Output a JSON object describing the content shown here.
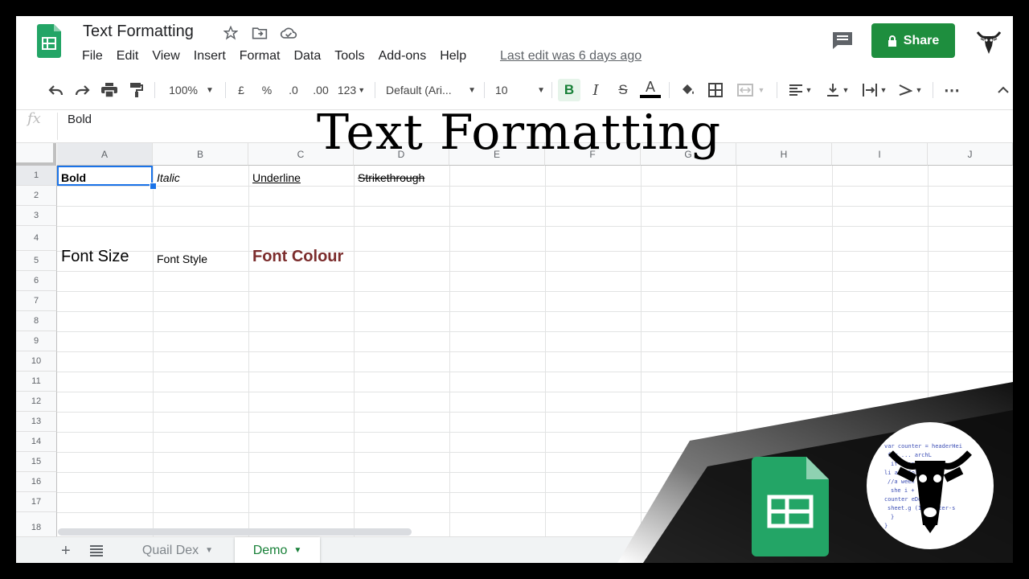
{
  "document": {
    "title": "Text Formatting"
  },
  "menu": {
    "items": [
      "File",
      "Edit",
      "View",
      "Insert",
      "Format",
      "Data",
      "Tools",
      "Add-ons",
      "Help"
    ],
    "last_edit": "Last edit was 6 days ago"
  },
  "share": {
    "label": "Share"
  },
  "toolbar": {
    "zoom": "100%",
    "currency": "£",
    "percent": "%",
    "dec_decrease": ".0",
    "dec_increase": ".00",
    "more_formats": "123",
    "font": "Default (Ari...",
    "font_size": "10",
    "bold": "B",
    "italic": "I",
    "strike": "S",
    "text_color": "A"
  },
  "formula_bar": {
    "fx": "fx",
    "value": "Bold"
  },
  "overlay": {
    "title": "Text Formatting"
  },
  "grid": {
    "columns": [
      "A",
      "B",
      "C",
      "D",
      "E",
      "F",
      "G",
      "H",
      "I",
      "J"
    ],
    "rows": [
      "1",
      "2",
      "3",
      "4",
      "5",
      "6",
      "7",
      "8",
      "9",
      "10",
      "11",
      "12",
      "13",
      "14",
      "15",
      "16",
      "17",
      "18"
    ],
    "cells": {
      "A1": "Bold",
      "B1": "Italic",
      "C1": "Underline",
      "D1": "Strikethrough",
      "A4": "Font Size",
      "B4": "Font Style",
      "C4": "Font Colour"
    },
    "font_colour": "#7b2c2c"
  },
  "sheets": {
    "tabs": [
      "Quail Dex",
      "Demo"
    ],
    "active": "Demo"
  },
  "colors": {
    "accent": "#1a73e8",
    "share_green": "#1e8e3e",
    "sheets_green": "#188038"
  },
  "icons": [
    "sheets-logo-icon",
    "star-icon",
    "folder-icon",
    "cloud-icon",
    "comment-icon",
    "lock-icon",
    "undo-icon",
    "redo-icon",
    "print-icon",
    "paint-format-icon",
    "fill-color-icon",
    "borders-icon",
    "merge-icon",
    "align-icon",
    "valign-icon",
    "wrap-icon",
    "rotate-icon",
    "more-icon",
    "collapse-icon"
  ],
  "decoration": {
    "code_lines": [
      "var counter = headerHei",
      "for ...      archL",
      "if          (searc",
      "li          archCol[i",
      "//a       ween grou",
      "she         i + count",
      "counter    eDepth;",
      "sheet.g     (1+counter-s",
      "}",
      "}"
    ]
  }
}
